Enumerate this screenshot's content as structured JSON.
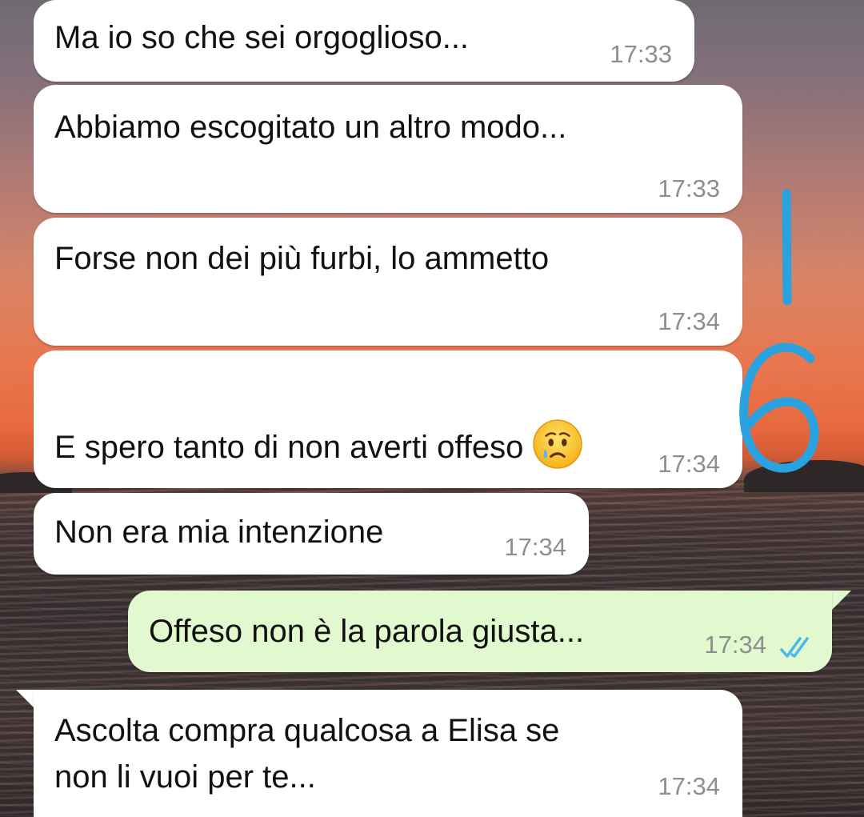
{
  "messages": [
    {
      "text": "Ma io so che sei orgoglioso...",
      "time": "17:33",
      "direction": "in"
    },
    {
      "text": "Abbiamo escogitato un altro modo...",
      "time": "17:33",
      "direction": "in"
    },
    {
      "text": "Forse non dei più furbi, lo ammetto",
      "time": "17:34",
      "direction": "in"
    },
    {
      "text": "E spero tanto di non averti offeso",
      "time": "17:34",
      "direction": "in",
      "emoji": "crying-face"
    },
    {
      "text": "Non era mia intenzione",
      "time": "17:34",
      "direction": "in"
    },
    {
      "text": "Offeso non è la parola giusta...",
      "time": "17:34",
      "direction": "out",
      "status": "read-double-check"
    },
    {
      "text": "Ascolta compra qualcosa a Elisa se\nnon li vuoi per te...",
      "time": "17:34",
      "direction": "in"
    }
  ],
  "annotation": {
    "text": "16",
    "color": "#2aa2e0"
  },
  "colors": {
    "incoming_bubble": "#ffffff",
    "outgoing_bubble": "#e2f8cf",
    "read_ticks": "#4fb6ec",
    "timestamp": "#8e8e8e"
  }
}
